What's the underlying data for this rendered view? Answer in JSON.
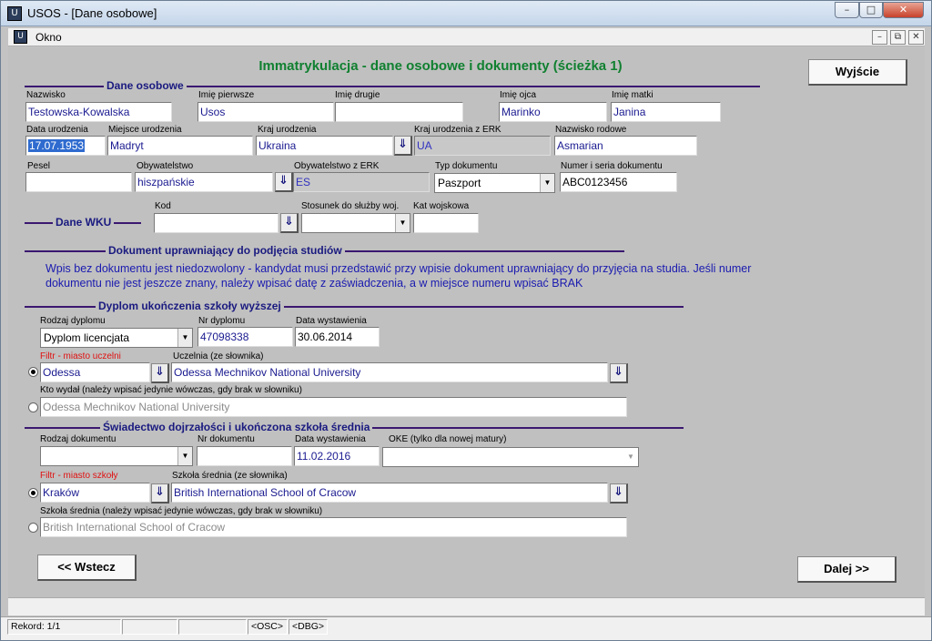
{
  "window": {
    "title": "USOS - [Dane osobowe]",
    "min": "–",
    "max": "□",
    "close": "✕"
  },
  "menu": {
    "okno": "Okno",
    "mdi_min": "–",
    "mdi_restore": "⧉",
    "mdi_close": "✕"
  },
  "heading": "Immatrykulacja - dane osobowe i dokumenty (ścieżka 1)",
  "buttons": {
    "exit": "Wyjście",
    "back": "<< Wstecz",
    "next": "Dalej >>"
  },
  "personal": {
    "section": "Dane osobowe",
    "nazwisko": {
      "label": "Nazwisko",
      "value": "Testowska-Kowalska"
    },
    "imie_pierwsze": {
      "label": "Imię pierwsze",
      "value": "Usos"
    },
    "imie_drugie": {
      "label": "Imię drugie",
      "value": ""
    },
    "imie_ojca": {
      "label": "Imię ojca",
      "value": "Marinko"
    },
    "imie_matki": {
      "label": "Imię matki",
      "value": "Janina"
    },
    "data_urodzenia": {
      "label": "Data urodzenia",
      "value": "17.07.1953"
    },
    "miejsce_urodzenia": {
      "label": "Miejsce urodzenia",
      "value": "Madryt"
    },
    "kraj_urodzenia": {
      "label": "Kraj urodzenia",
      "value": "Ukraina"
    },
    "kraj_erk": {
      "label": "Kraj urodzenia z ERK",
      "value": "UA"
    },
    "nazwisko_rodowe": {
      "label": "Nazwisko rodowe",
      "value": "Asmarian"
    },
    "pesel": {
      "label": "Pesel",
      "value": ""
    },
    "obywatelstwo": {
      "label": "Obywatelstwo",
      "value": "hiszpańskie"
    },
    "obywatelstwo_erk": {
      "label": "Obywatelstwo z ERK",
      "value": "ES"
    },
    "typ_dokumentu": {
      "label": "Typ dokumentu",
      "value": "Paszport"
    },
    "numer_dokumentu": {
      "label": "Numer i seria dokumentu",
      "value": "ABC0123456"
    }
  },
  "wku": {
    "section": "Dane WKU",
    "kod": {
      "label": "Kod",
      "value": ""
    },
    "stosunek": {
      "label": "Stosunek do służby woj.",
      "value": ""
    },
    "kat": {
      "label": "Kat wojskowa",
      "value": ""
    }
  },
  "dokument": {
    "section": "Dokument uprawniający do podjęcia studiów",
    "info": "Wpis bez dokumentu jest niedozwolony - kandydat musi przedstawić przy wpisie dokument uprawniający do przyjęcia na studia. Jeśli numer dokumentu nie jest jeszcze znany, należy wpisać datę z zaświadczenia, a w miejsce numeru wpisać BRAK"
  },
  "dyplom": {
    "section": "Dyplom ukończenia szkoły wyższej",
    "rodzaj": {
      "label": "Rodzaj dyplomu",
      "value": "Dyplom licencjata"
    },
    "nr": {
      "label": "Nr dyplomu",
      "value": "47098338"
    },
    "data": {
      "label": "Data wystawienia",
      "value": "30.06.2014"
    },
    "filtr": {
      "label": "Filtr - miasto uczelni",
      "value": "Odessa"
    },
    "uczelnia": {
      "label": "Uczelnia (ze słownika)",
      "value": "Odessa Mechnikov National University"
    },
    "kto": {
      "label": "Kto wydał (należy wpisać jedynie wówczas, gdy brak w słowniku)",
      "value": "Odessa Mechnikov National University"
    }
  },
  "matura": {
    "section": "Świadectwo dojrzałości i ukończona szkoła średnia",
    "rodzaj": {
      "label": "Rodzaj dokumentu",
      "value": ""
    },
    "nr": {
      "label": "Nr dokumentu",
      "value": ""
    },
    "data": {
      "label": "Data wystawienia",
      "value": "11.02.2016"
    },
    "oke": {
      "label": "OKE (tylko dla nowej matury)",
      "value": ""
    },
    "filtr": {
      "label": "Filtr - miasto szkoły",
      "value": "Kraków"
    },
    "szkola": {
      "label": "Szkoła średnia (ze słownika)",
      "value": "British International School of Cracow"
    },
    "szkola_txt": {
      "label": "Szkoła średnia (należy wpisać jedynie wówczas, gdy brak w słowniku)",
      "value": "British International School of Cracow"
    }
  },
  "status": {
    "rekord": "Rekord: 1/1",
    "osc": "<OSC>",
    "dbg": "<DBG>"
  },
  "icons": {
    "download": "⇓",
    "dropdown": "▼"
  }
}
